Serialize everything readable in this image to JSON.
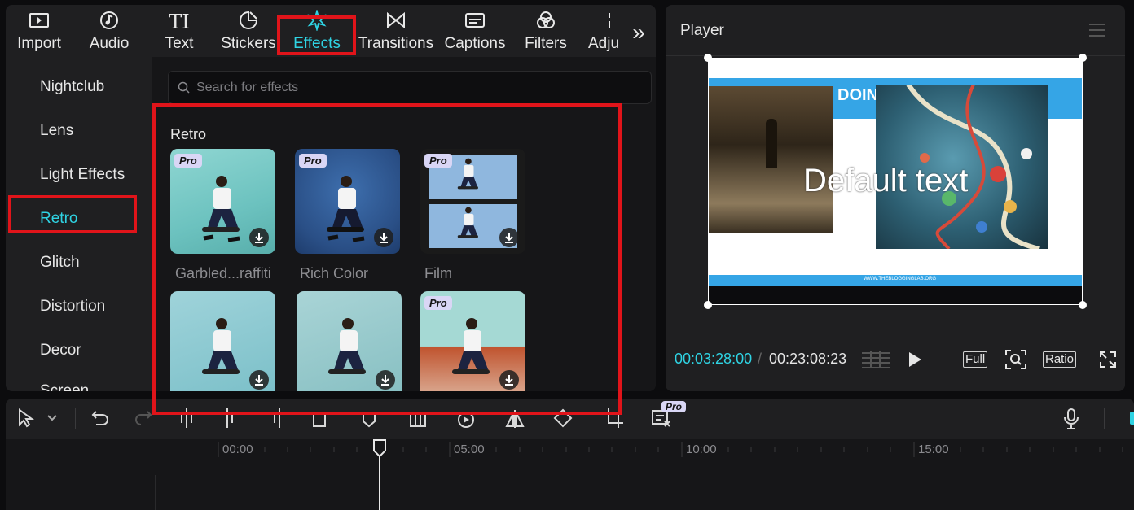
{
  "tabs": [
    {
      "label": "Import",
      "icon": "import-icon"
    },
    {
      "label": "Audio",
      "icon": "audio-icon"
    },
    {
      "label": "Text",
      "icon": "text-icon"
    },
    {
      "label": "Stickers",
      "icon": "stickers-icon"
    },
    {
      "label": "Effects",
      "icon": "effects-icon",
      "active": true
    },
    {
      "label": "Transitions",
      "icon": "transitions-icon"
    },
    {
      "label": "Captions",
      "icon": "captions-icon"
    },
    {
      "label": "Filters",
      "icon": "filters-icon"
    },
    {
      "label": "Adju",
      "icon": "adjust-icon"
    }
  ],
  "sidebar": {
    "items": [
      {
        "label": "Nightclub"
      },
      {
        "label": "Lens"
      },
      {
        "label": "Light Effects"
      },
      {
        "label": "Retro",
        "active": true
      },
      {
        "label": "Glitch"
      },
      {
        "label": "Distortion"
      },
      {
        "label": "Decor"
      },
      {
        "label": "Screen"
      }
    ]
  },
  "search": {
    "placeholder": "Search for effects"
  },
  "section": {
    "title": "Retro"
  },
  "cards": [
    {
      "label": "Garbled...raffiti",
      "pro": "Pro"
    },
    {
      "label": "Rich Color",
      "pro": "Pro"
    },
    {
      "label": "Film",
      "pro": "Pro"
    },
    {
      "label": "",
      "pro": ""
    },
    {
      "label": "",
      "pro": ""
    },
    {
      "label": "",
      "pro": "Pro"
    }
  ],
  "player": {
    "title": "Player",
    "current_time": "00:03:28:00",
    "separator": "/",
    "total_time": "00:23:08:23",
    "preview_text": "Default text",
    "preview_header": "DOING",
    "preview_footer": "WWW.THEBLOGGINGLAB.ORG",
    "btn_full": "Full",
    "btn_ratio": "Ratio"
  },
  "toolbar": {
    "pro_badge": "Pro"
  },
  "ruler": {
    "labels": [
      "00:00",
      "05:00",
      "10:00",
      "15:00"
    ]
  },
  "colors": {
    "accent": "#2fd3e3",
    "highlight": "#e0141a"
  }
}
